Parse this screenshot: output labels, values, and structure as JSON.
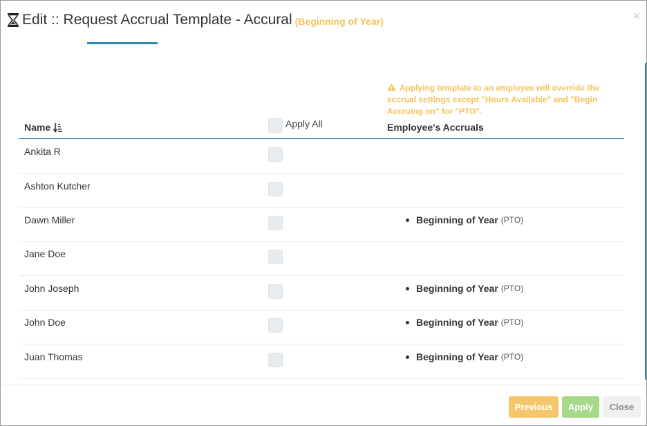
{
  "dialog": {
    "title": "Edit :: Request Accrual Template - Accural",
    "subtitle": "(Beginning of Year)",
    "close_glyph": "×",
    "warning": "Applying template to an employee will override the accrual settings except \"Hours Available\" and \"Begin Accruing on\" for \"PTO\"."
  },
  "table": {
    "headers": {
      "name": "Name",
      "apply_all": "Apply All",
      "accruals": "Employee's Accruals"
    },
    "rows": [
      {
        "name": "Ankita R",
        "accrual": "",
        "type": ""
      },
      {
        "name": "Ashton Kutcher",
        "accrual": "",
        "type": ""
      },
      {
        "name": "Dawn Miller",
        "accrual": "Beginning of Year",
        "type": "(PTO)"
      },
      {
        "name": "Jane Doe",
        "accrual": "",
        "type": ""
      },
      {
        "name": "John Joseph",
        "accrual": "Beginning of Year",
        "type": "(PTO)"
      },
      {
        "name": "John Doe",
        "accrual": "Beginning of Year",
        "type": "(PTO)"
      },
      {
        "name": "Juan Thomas",
        "accrual": "Beginning of Year",
        "type": "(PTO)"
      }
    ]
  },
  "footer": {
    "previous": "Previous",
    "apply": "Apply",
    "close": "Close"
  },
  "icons": {
    "title_icon": "hourglass-icon",
    "sort_icon": "sort-descending-icon",
    "warning_icon": "warning-triangle-icon"
  },
  "colors": {
    "accent": "#2a8ab0",
    "warning": "#f4c35a",
    "previous_button": "#f4c86a",
    "apply_button": "#a6d98a",
    "close_button": "#f0f0f0"
  }
}
